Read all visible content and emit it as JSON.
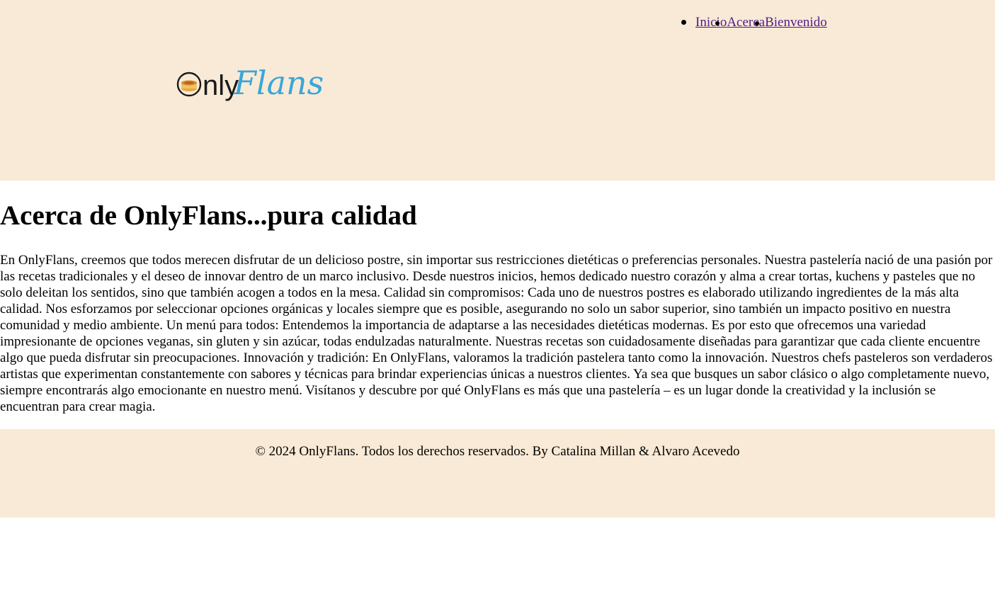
{
  "header": {
    "nav": [
      {
        "label": "Inicio"
      },
      {
        "label": "Acerca"
      },
      {
        "label": "Bienvenido"
      }
    ],
    "logo": {
      "brand_left": "Only",
      "brand_right": "Flans",
      "icon": "flan-icon",
      "colors": {
        "left": "#1a1a1a",
        "right": "#3aa6d8",
        "flan_top": "#d98a2b",
        "flan_base": "#f2c267"
      }
    }
  },
  "main": {
    "title": "Acerca de OnlyFlans...pura calidad",
    "body": "En OnlyFlans, creemos que todos merecen disfrutar de un delicioso postre, sin importar sus restricciones dietéticas o preferencias personales. Nuestra pastelería nació de una pasión por las recetas tradicionales y el deseo de innovar dentro de un marco inclusivo. Desde nuestros inicios, hemos dedicado nuestro corazón y alma a crear tortas, kuchens y pasteles que no solo deleitan los sentidos, sino que también acogen a todos en la mesa. Calidad sin compromisos: Cada uno de nuestros postres es elaborado utilizando ingredientes de la más alta calidad. Nos esforzamos por seleccionar opciones orgánicas y locales siempre que es posible, asegurando no solo un sabor superior, sino también un impacto positivo en nuestra comunidad y medio ambiente. Un menú para todos: Entendemos la importancia de adaptarse a las necesidades dietéticas modernas. Es por esto que ofrecemos una variedad impresionante de opciones veganas, sin gluten y sin azúcar, todas endulzadas naturalmente. Nuestras recetas son cuidadosamente diseñadas para garantizar que cada cliente encuentre algo que pueda disfrutar sin preocupaciones. Innovación y tradición: En OnlyFlans, valoramos la tradición pastelera tanto como la innovación. Nuestros chefs pasteleros son verdaderos artistas que experimentan constantemente con sabores y técnicas para brindar experiencias únicas a nuestros clientes. Ya sea que busques un sabor clásico o algo completamente nuevo, siempre encontrarás algo emocionante en nuestro menú. Visítanos y descubre por qué OnlyFlans es más que una pastelería – es un lugar donde la creatividad y la inclusión se encuentran para crear magia."
  },
  "footer": {
    "text": "© 2024 OnlyFlans. Todos los derechos reservados. By Catalina Millan & Alvaro Acevedo"
  },
  "colors": {
    "header_bg": "#f8ead6",
    "footer_bg": "#f8ead6",
    "link": "#551a8b"
  }
}
